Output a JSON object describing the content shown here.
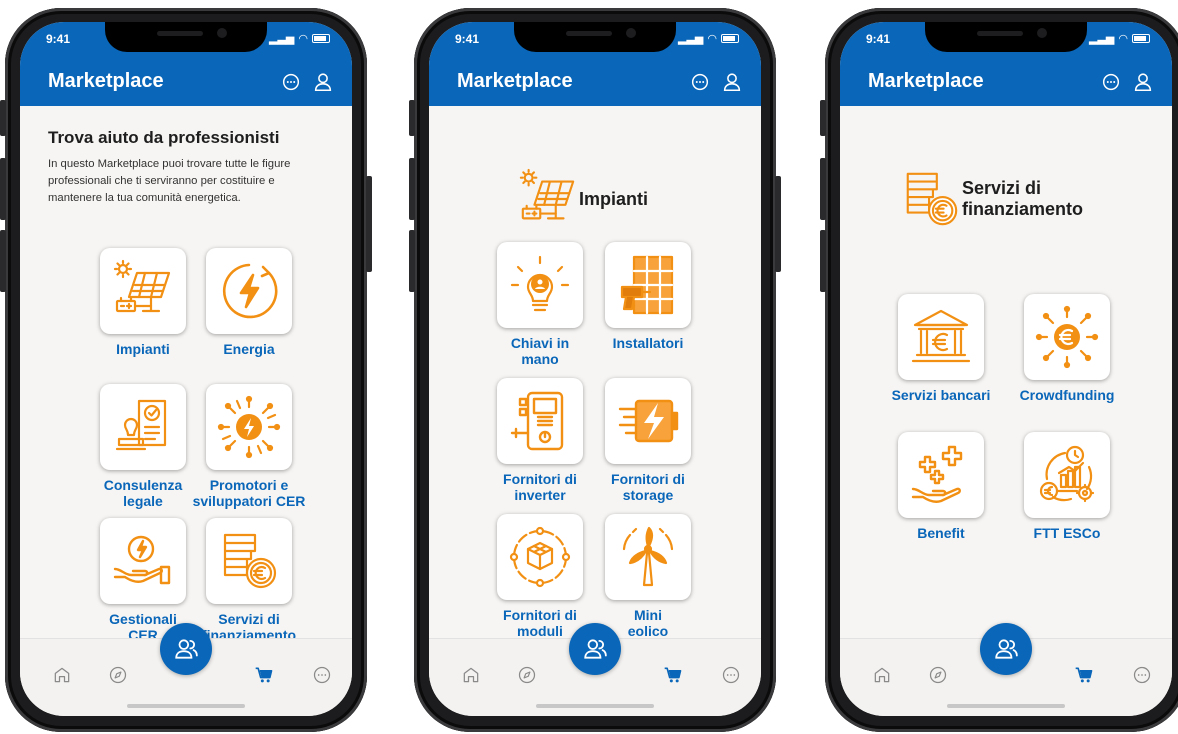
{
  "status": {
    "time": "9:41"
  },
  "app": {
    "title": "Marketplace"
  },
  "screen1": {
    "intro_title": "Trova aiuto da professionisti",
    "intro_text": "In questo Marketplace puoi trovare tutte le figure professionali che ti serviranno per costituire e mantenere la tua comunità energetica.",
    "tiles": [
      {
        "label": "Impianti",
        "icon": "solar-panel-icon"
      },
      {
        "label": "Energia",
        "icon": "lightning-circle-icon"
      },
      {
        "label": "Consulenza legale",
        "icon": "legal-stamp-icon"
      },
      {
        "label": "Promotori e sviluppatori CER",
        "icon": "energy-network-icon"
      },
      {
        "label": "Gestionali CER",
        "icon": "hand-energy-icon"
      },
      {
        "label": "Servizi di finanziamento",
        "icon": "coins-euro-icon"
      }
    ]
  },
  "screen2": {
    "section_title": "Impianti",
    "tiles": [
      {
        "label": "Chiavi in mano",
        "icon": "bulb-gear-icon"
      },
      {
        "label": "Installatori",
        "icon": "installer-drill-icon"
      },
      {
        "label": "Fornitori di inverter",
        "icon": "inverter-icon"
      },
      {
        "label": "Fornitori di storage",
        "icon": "battery-icon"
      },
      {
        "label": "Fornitori di moduli",
        "icon": "modules-cube-icon"
      },
      {
        "label": "Mini eolico",
        "icon": "wind-turbine-icon"
      }
    ]
  },
  "screen3": {
    "section_title": "Servizi di finanziamento",
    "tiles": [
      {
        "label": "Servizi bancari",
        "icon": "bank-euro-icon"
      },
      {
        "label": "Crowdfunding",
        "icon": "euro-network-icon"
      },
      {
        "label": "Benefit",
        "icon": "hand-plus-icon"
      },
      {
        "label": "FTT ESCo",
        "icon": "growth-cycle-icon"
      }
    ]
  },
  "nav": {
    "items": [
      "home",
      "explore",
      "community",
      "cart",
      "more"
    ]
  },
  "colors": {
    "primary": "#0a66b8",
    "accent": "#f29014",
    "background": "#f7f5f3"
  }
}
